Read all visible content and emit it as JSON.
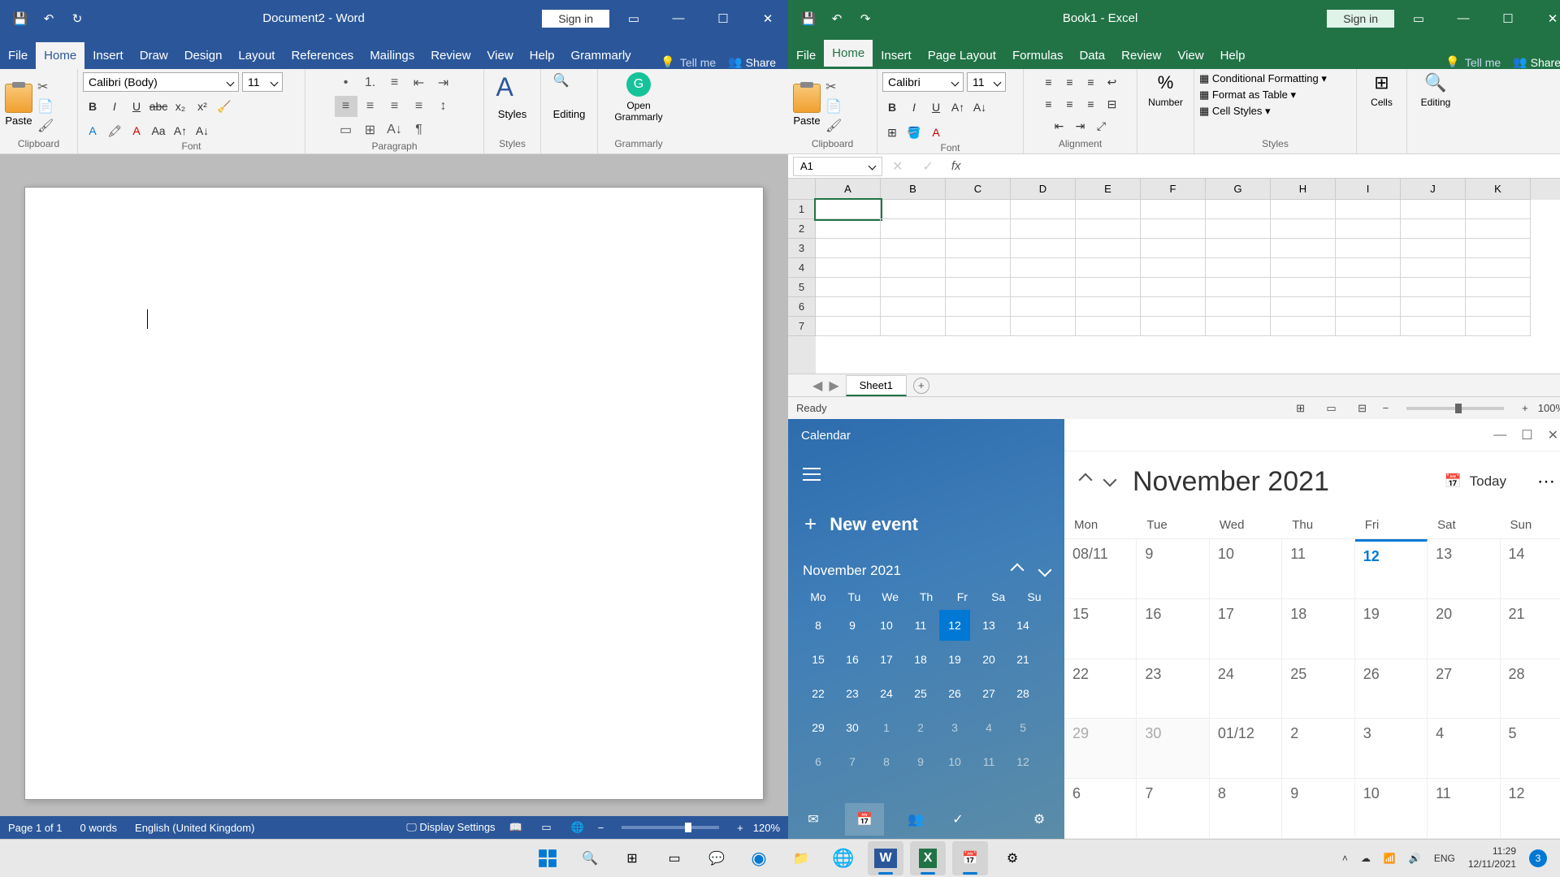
{
  "word": {
    "title": "Document2 - Word",
    "signin": "Sign in",
    "tabs": [
      "File",
      "Home",
      "Insert",
      "Draw",
      "Design",
      "Layout",
      "References",
      "Mailings",
      "Review",
      "View",
      "Help",
      "Grammarly"
    ],
    "tellme": "Tell me",
    "share": "Share",
    "font_name": "Calibri (Body)",
    "font_size": "11",
    "groups": {
      "clipboard": "Clipboard",
      "font": "Font",
      "paragraph": "Paragraph",
      "styles": "Styles",
      "editing": "Editing",
      "grammarly": "Grammarly"
    },
    "paste": "Paste",
    "styles": "Styles",
    "editing": "Editing",
    "open_grammarly": "Open Grammarly",
    "status": {
      "page": "Page 1 of 1",
      "words": "0 words",
      "lang": "English (United Kingdom)",
      "display": "Display Settings",
      "zoom": "120%"
    }
  },
  "excel": {
    "title": "Book1 - Excel",
    "signin": "Sign in",
    "tabs": [
      "File",
      "Home",
      "Insert",
      "Page Layout",
      "Formulas",
      "Data",
      "Review",
      "View",
      "Help"
    ],
    "tellme": "Tell me",
    "share": "Share",
    "font_name": "Calibri",
    "font_size": "11",
    "paste": "Paste",
    "groups": {
      "clipboard": "Clipboard",
      "font": "Font",
      "alignment": "Alignment",
      "number": "Number",
      "styles": "Styles",
      "cells": "Cells",
      "editing": "Editing"
    },
    "number": "Number",
    "cond_fmt": "Conditional Formatting",
    "fmt_table": "Format as Table",
    "cell_styles": "Cell Styles",
    "cells": "Cells",
    "editing": "Editing",
    "name_box": "A1",
    "cols": [
      "A",
      "B",
      "C",
      "D",
      "E",
      "F",
      "G",
      "H",
      "I",
      "J",
      "K"
    ],
    "rows": [
      "1",
      "2",
      "3",
      "4",
      "5",
      "6",
      "7"
    ],
    "sheet": "Sheet1",
    "status": {
      "ready": "Ready",
      "zoom": "100%"
    }
  },
  "cal": {
    "title": "Calendar",
    "new_event": "New event",
    "mini_month": "November 2021",
    "mini_dow": [
      "Mo",
      "Tu",
      "We",
      "Th",
      "Fr",
      "Sa",
      "Su"
    ],
    "mini_days": [
      {
        "n": "8"
      },
      {
        "n": "9"
      },
      {
        "n": "10"
      },
      {
        "n": "11"
      },
      {
        "n": "12",
        "today": true
      },
      {
        "n": "13"
      },
      {
        "n": "14"
      },
      {
        "n": "15"
      },
      {
        "n": "16"
      },
      {
        "n": "17"
      },
      {
        "n": "18"
      },
      {
        "n": "19"
      },
      {
        "n": "20"
      },
      {
        "n": "21"
      },
      {
        "n": "22"
      },
      {
        "n": "23"
      },
      {
        "n": "24"
      },
      {
        "n": "25"
      },
      {
        "n": "26"
      },
      {
        "n": "27"
      },
      {
        "n": "28"
      },
      {
        "n": "29"
      },
      {
        "n": "30"
      },
      {
        "n": "1",
        "other": true
      },
      {
        "n": "2",
        "other": true
      },
      {
        "n": "3",
        "other": true
      },
      {
        "n": "4",
        "other": true
      },
      {
        "n": "5",
        "other": true
      },
      {
        "n": "6",
        "other": true
      },
      {
        "n": "7",
        "other": true
      },
      {
        "n": "8",
        "other": true
      },
      {
        "n": "9",
        "other": true
      },
      {
        "n": "10",
        "other": true
      },
      {
        "n": "11",
        "other": true
      },
      {
        "n": "12",
        "other": true
      }
    ],
    "big_month": "November 2021",
    "today": "Today",
    "big_dow": [
      "Mon",
      "Tue",
      "Wed",
      "Thu",
      "Fri",
      "Sat",
      "Sun"
    ],
    "big_days": [
      [
        {
          "n": "08/11"
        },
        {
          "n": "9"
        },
        {
          "n": "10"
        },
        {
          "n": "11"
        },
        {
          "n": "12",
          "today": true
        },
        {
          "n": "13"
        },
        {
          "n": "14"
        }
      ],
      [
        {
          "n": "15"
        },
        {
          "n": "16"
        },
        {
          "n": "17"
        },
        {
          "n": "18"
        },
        {
          "n": "19"
        },
        {
          "n": "20"
        },
        {
          "n": "21"
        }
      ],
      [
        {
          "n": "22"
        },
        {
          "n": "23"
        },
        {
          "n": "24"
        },
        {
          "n": "25"
        },
        {
          "n": "26"
        },
        {
          "n": "27"
        },
        {
          "n": "28"
        }
      ],
      [
        {
          "n": "29",
          "muted": true
        },
        {
          "n": "30",
          "muted": true
        },
        {
          "n": "01/12"
        },
        {
          "n": "2"
        },
        {
          "n": "3"
        },
        {
          "n": "4"
        },
        {
          "n": "5"
        }
      ],
      [
        {
          "n": "6"
        },
        {
          "n": "7"
        },
        {
          "n": "8"
        },
        {
          "n": "9"
        },
        {
          "n": "10"
        },
        {
          "n": "11"
        },
        {
          "n": "12"
        }
      ]
    ]
  },
  "taskbar": {
    "time": "11:29",
    "date": "12/11/2021",
    "badge": "3"
  }
}
